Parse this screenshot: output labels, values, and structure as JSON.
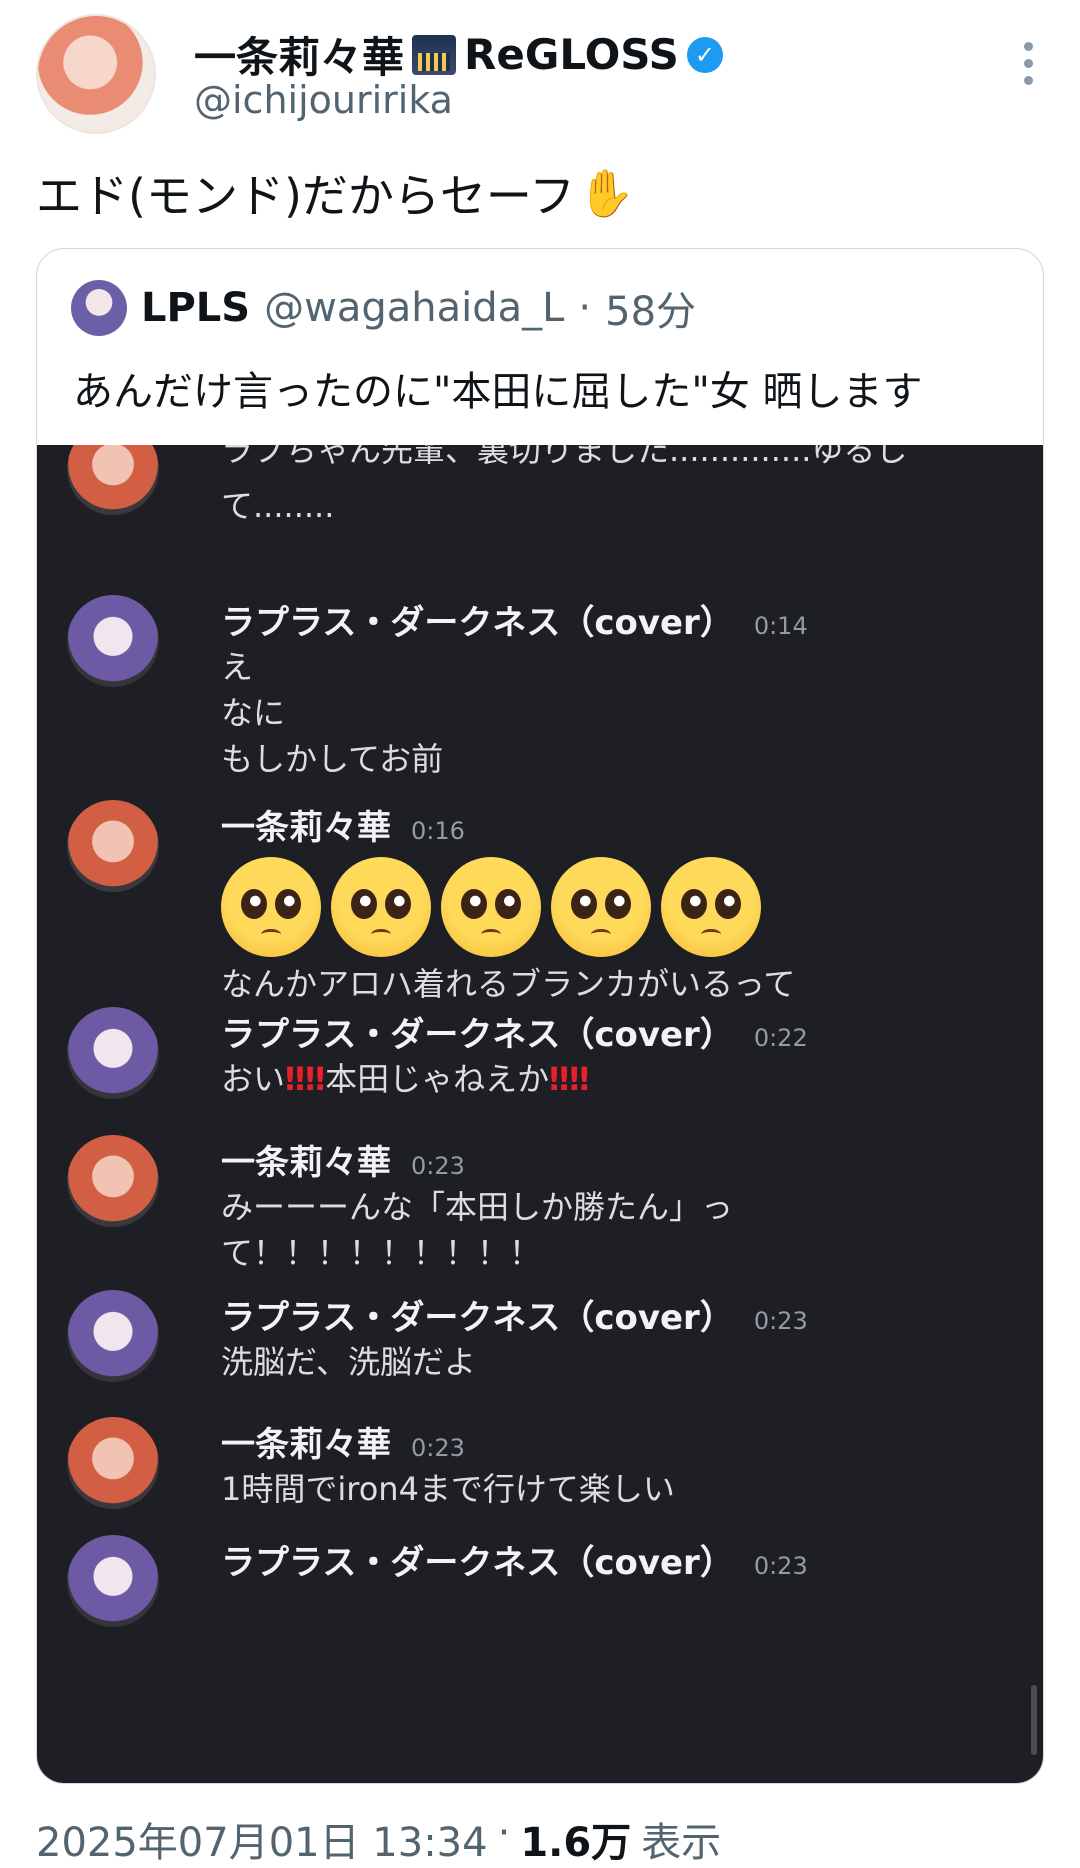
{
  "author": {
    "display_name": "一条莉々華",
    "name_suffix": "ReGLOSS",
    "handle": "@ichijouririka",
    "verified_mark": "✓"
  },
  "tweet": {
    "text": "エド(モンド)だからセーフ",
    "emoji": "✋"
  },
  "quote": {
    "name": "LPLS",
    "handle": "@wagahaida_L",
    "separator": "·",
    "time_ago": "58分",
    "text": "あんだけ言ったのに\"本田に屈した\"女 晒します"
  },
  "chat": {
    "messages": [
      {
        "lines": [
          "ラプちゃん先輩、裏切りました..............ゆるし",
          "て........"
        ]
      },
      {
        "author": "ラプラス・ダークネス（cover）",
        "time": "0:14",
        "lines": [
          "え",
          "なに",
          "もしかしてお前"
        ]
      },
      {
        "author": "一条莉々華",
        "time": "0:16",
        "emoji_count": 5,
        "lines": [
          "なんかアロハ着れるブランカがいるって"
        ]
      },
      {
        "author": "ラプラス・ダークネス（cover）",
        "time": "0:22",
        "line_a": "おい",
        "bang": "‼‼",
        "line_b": "本田じゃねえか",
        "bang2": "‼‼"
      },
      {
        "author": "一条莉々華",
        "time": "0:23",
        "lines": [
          "みーーーんな「本田しか勝たん」っ",
          "て！！！！！！！！！"
        ]
      },
      {
        "author": "ラプラス・ダークネス（cover）",
        "time": "0:23",
        "lines": [
          "洗脳だ、洗脳だよ"
        ]
      },
      {
        "author": "一条莉々華",
        "time": "0:23",
        "lines": [
          "1時間でiron4まで行けて楽しい"
        ]
      },
      {
        "author": "ラプラス・ダークネス（cover）",
        "time": "0:23"
      }
    ]
  },
  "footer": {
    "date": "2025年07月01日 13:34",
    "separator": "·",
    "views": "1.6万",
    "views_label": "表示"
  }
}
